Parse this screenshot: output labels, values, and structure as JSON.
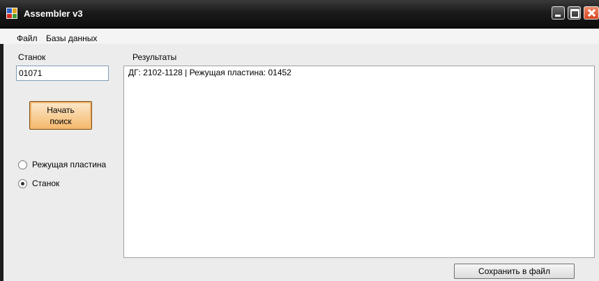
{
  "window": {
    "title": "Assembler v3",
    "icon": "app-icon"
  },
  "menu": {
    "items": [
      "Файл",
      "Базы данных"
    ]
  },
  "machine": {
    "label": "Станок",
    "value": "01071"
  },
  "search_button": {
    "line1": "Начать",
    "line2": "поиск"
  },
  "mode": {
    "options": [
      {
        "label": "Режущая пластина",
        "selected": false
      },
      {
        "label": "Станок",
        "selected": true
      }
    ]
  },
  "results": {
    "label": "Результаты",
    "lines": [
      "ДГ: 2102-1128 | Режущая пластина: 01452"
    ]
  },
  "save_button": {
    "label": "Сохранить в файл"
  },
  "colors": {
    "titlebar": "#1a1a1a",
    "close_button": "#d8431d",
    "search_button": "#f5b96b"
  }
}
